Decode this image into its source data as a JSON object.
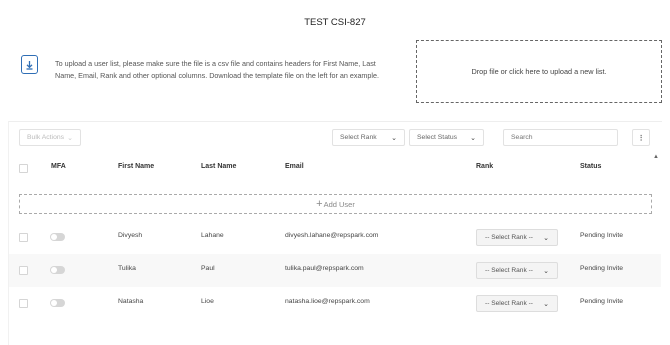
{
  "page": {
    "title": "TEST CSI-827",
    "instructions": "To upload a user list, please make sure the file is a csv file and contains headers for First Name, Last Name, Email, Rank and other optional columns. Download the template file on the left for an example.",
    "dropzone_text": "Drop file or click here to upload a new list.",
    "template_icon": "file-download-icon"
  },
  "toolbar": {
    "bulk_actions": "Bulk Actions",
    "select_rank": "Select Rank",
    "select_status": "Select Status",
    "search_placeholder": "Search",
    "more": "⋮"
  },
  "table": {
    "headers": {
      "mfa": "MFA",
      "first_name": "First Name",
      "last_name": "Last Name",
      "email": "Email",
      "rank": "Rank",
      "status": "Status"
    },
    "add_user": "Add User",
    "rows": [
      {
        "first": "Divyesh",
        "last": "Lahane",
        "email": "divyesh.lahane@repspark.com",
        "rank": "-- Select Rank --",
        "status": "Pending Invite"
      },
      {
        "first": "Tulika",
        "last": "Paul",
        "email": "tulika.paul@repspark.com",
        "rank": "-- Select Rank --",
        "status": "Pending Invite"
      },
      {
        "first": "Natasha",
        "last": "Lioe",
        "email": "natasha.lioe@repspark.com",
        "rank": "-- Select Rank --",
        "status": "Pending Invite"
      }
    ]
  },
  "colors": {
    "accent": "#2f6eb5",
    "toggle_off": "#d6d6d6",
    "row_alt": "#f8f8f8"
  }
}
